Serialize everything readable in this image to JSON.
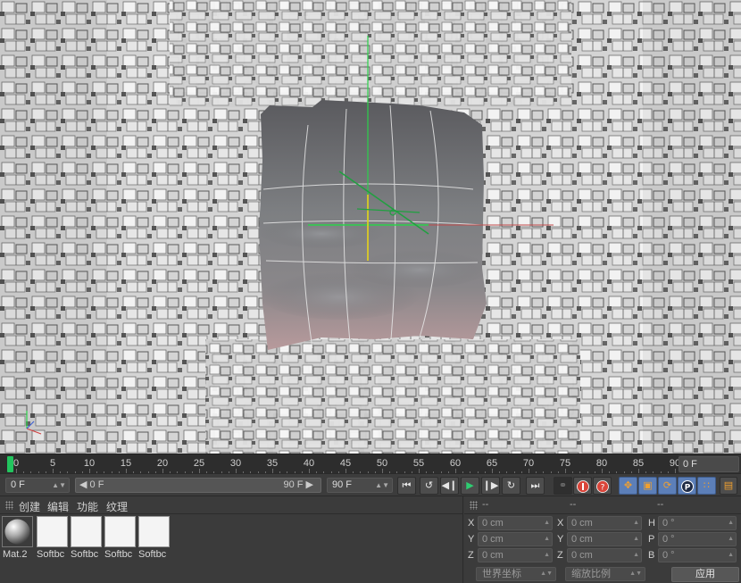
{
  "timeline": {
    "ticks": [
      "0",
      "5",
      "10",
      "15",
      "20",
      "25",
      "30",
      "35",
      "40",
      "45",
      "50",
      "55",
      "60",
      "65",
      "70",
      "75",
      "80",
      "85",
      "90"
    ],
    "current_frame_display": "0 F"
  },
  "transport": {
    "current_frame": "0 F",
    "range_start": "0 F",
    "range_end": "90 F",
    "max_frame": "90 F"
  },
  "materials": {
    "menu": [
      "创建",
      "编辑",
      "功能",
      "纹理"
    ],
    "items": [
      {
        "label": "Mat.2"
      },
      {
        "label": "Softbc"
      },
      {
        "label": "Softbc"
      },
      {
        "label": "Softbc"
      },
      {
        "label": "Softbc"
      }
    ]
  },
  "coordinates": {
    "col_heads": [
      "--",
      "--",
      "--"
    ],
    "position": [
      {
        "axis": "X",
        "value": "0 cm"
      },
      {
        "axis": "Y",
        "value": "0 cm"
      },
      {
        "axis": "Z",
        "value": "0 cm"
      }
    ],
    "size": [
      {
        "axis": "X",
        "value": "0 cm"
      },
      {
        "axis": "Y",
        "value": "0 cm"
      },
      {
        "axis": "Z",
        "value": "0 cm"
      }
    ],
    "rotation": [
      {
        "axis": "H",
        "value": "0 °"
      },
      {
        "axis": "P",
        "value": "0 °"
      },
      {
        "axis": "B",
        "value": "0 °"
      }
    ],
    "mode_dropdown": "世界坐标",
    "scale_dropdown": "缩放比例",
    "apply_label": "应用"
  },
  "colors": {
    "accent_green": "#22c55e",
    "keyframe_red": "#d9453a",
    "tool_blue": "#5c7fb8"
  }
}
